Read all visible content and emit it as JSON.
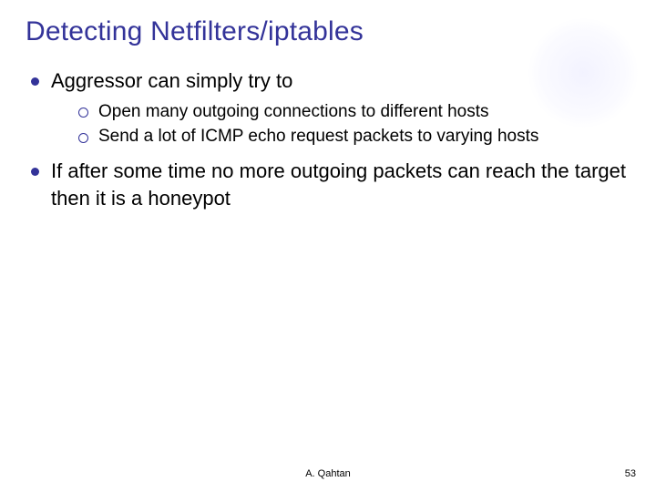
{
  "title": "Detecting Netfilters/iptables",
  "bullets": [
    {
      "text": "Aggressor can simply try to",
      "sub": [
        "Open many outgoing connections to different hosts",
        "Send a lot of ICMP echo request packets to varying hosts"
      ]
    },
    {
      "text": "If after some time no more outgoing packets can reach the target then it is a honeypot",
      "sub": []
    }
  ],
  "footer": {
    "author": "A. Qahtan",
    "page": "53"
  }
}
